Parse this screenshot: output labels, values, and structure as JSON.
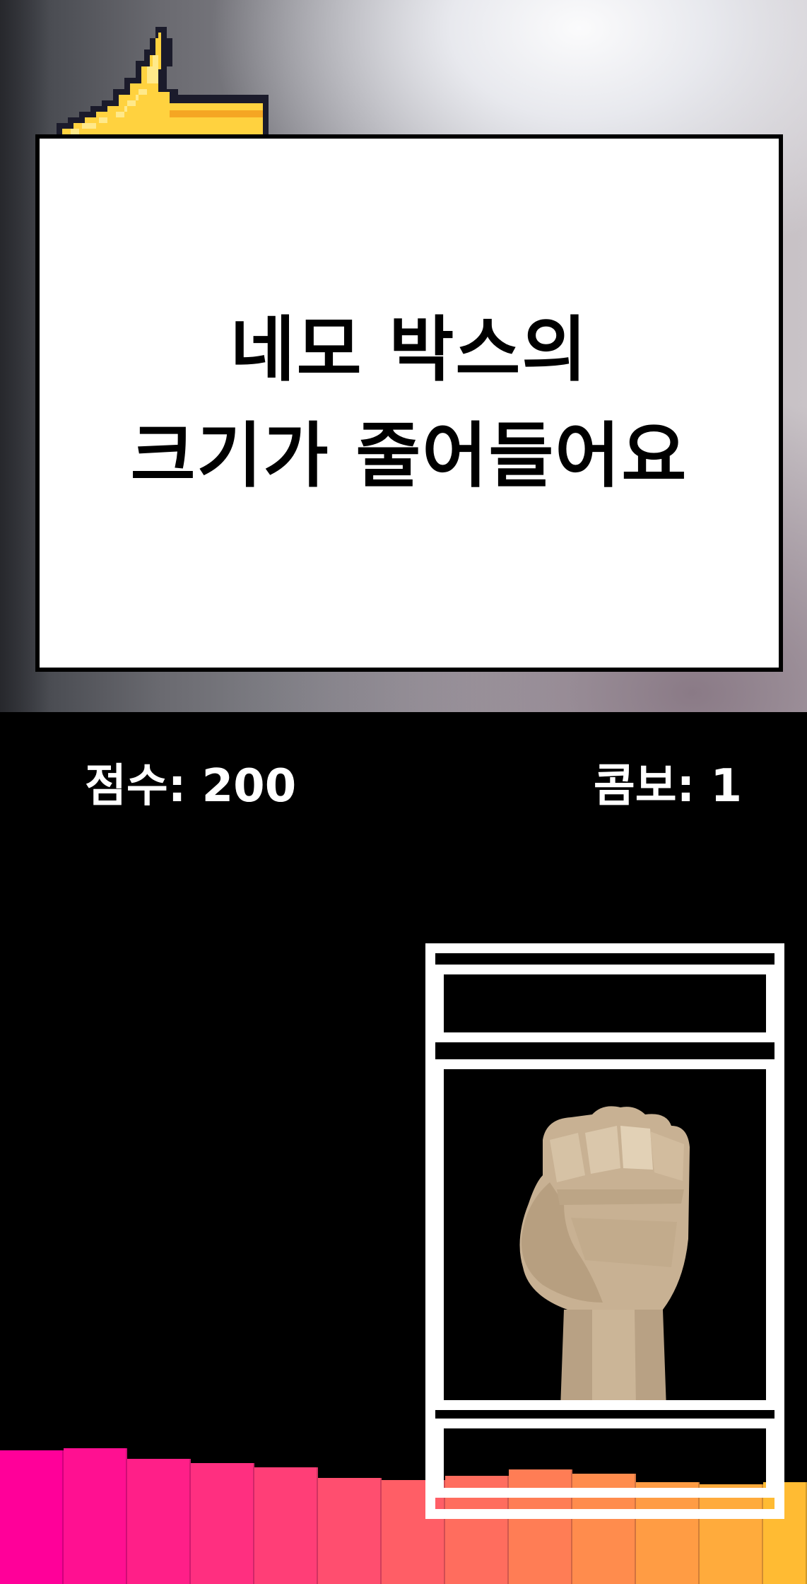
{
  "instruction": {
    "line1": "네모 박스의",
    "line2": "크기가 줄어들어요"
  },
  "hud": {
    "score_text": "점수: 200",
    "combo_text": "콤보: 1"
  },
  "target": {
    "gesture": "fist",
    "gesture_icon": "fist-icon"
  },
  "equalizer": {
    "colors_from": "#ff0099",
    "colors_to": "#ffbb33",
    "levels": [
      0.63,
      0.64,
      0.59,
      0.57,
      0.55,
      0.5,
      0.49,
      0.51,
      0.54,
      0.52,
      0.48,
      0.47,
      0.48
    ]
  },
  "cursor_icon": "pixel-hand-pointer-icon"
}
